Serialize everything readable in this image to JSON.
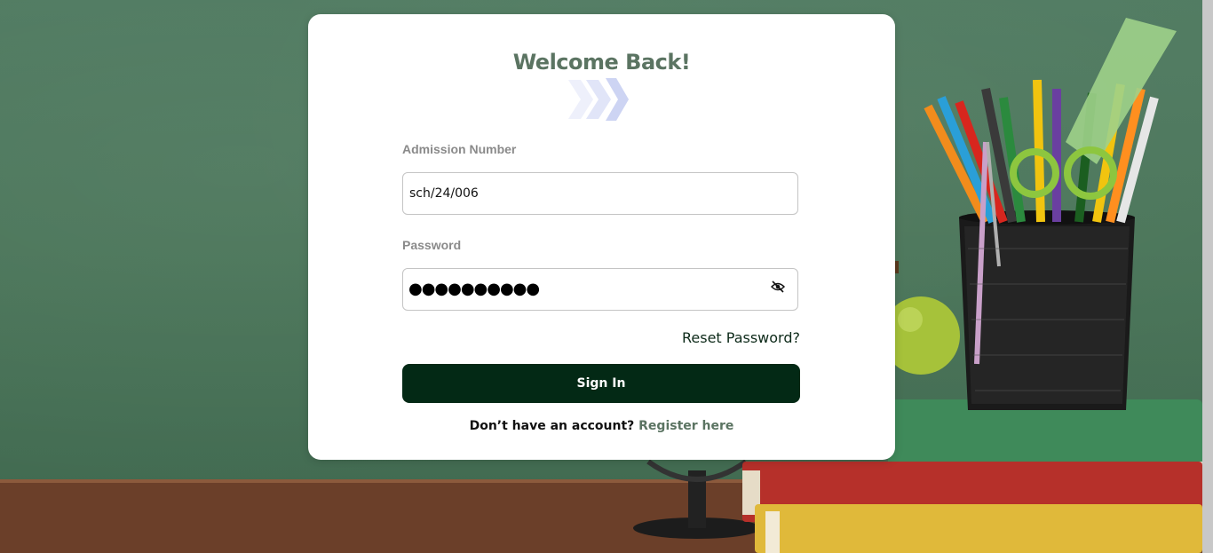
{
  "card": {
    "title": "Welcome Back!"
  },
  "admission": {
    "label": "Admission Number",
    "value": "sch/24/006"
  },
  "password": {
    "label": "Password",
    "masked_value": "●●●●●●●●●●"
  },
  "links": {
    "reset_password": "Reset Password?",
    "register_prompt": "Don’t have an account?",
    "register": "Register here"
  },
  "buttons": {
    "sign_in": "Sign In"
  },
  "icons": {
    "logo": "chevron-arrows-logo",
    "password_toggle": "eye-slash-icon"
  },
  "colors": {
    "primary_dark_green": "#032915",
    "title_green": "#5b7462",
    "background_green": "#4a7559"
  }
}
